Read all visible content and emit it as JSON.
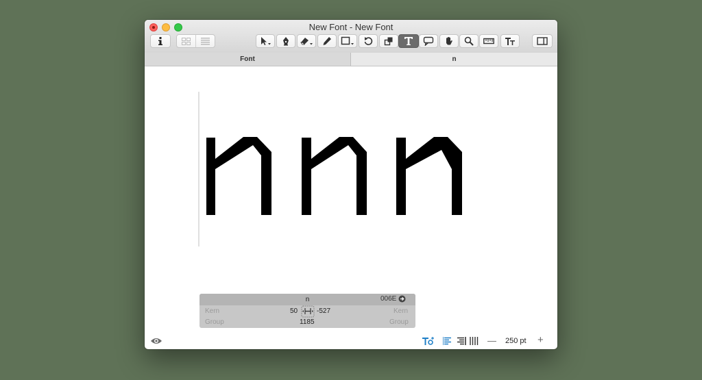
{
  "window": {
    "title": "New Font - New Font"
  },
  "tabs": [
    {
      "label": "Font"
    },
    {
      "label": "n"
    }
  ],
  "toolbar": {
    "tools": [
      "info-icon",
      "grid-view-icon",
      "list-view-icon",
      "select-tool-icon",
      "draw-tool-icon",
      "eraser-tool-icon",
      "pencil-tool-icon",
      "rectangle-tool-icon",
      "rotate-tool-icon",
      "scale-tool-icon",
      "text-tool-icon",
      "annotation-tool-icon",
      "hand-tool-icon",
      "zoom-tool-icon",
      "measure-tool-icon",
      "text-size-icon",
      "sidebar-toggle-icon"
    ],
    "active_tool": "text-tool-icon"
  },
  "canvas": {
    "glyphs": [
      "n",
      "n",
      "n"
    ]
  },
  "info_panel": {
    "glyph_name": "n",
    "unicode": "006E",
    "left_kern_label": "Kern",
    "right_kern_label": "Kern",
    "left_kern_value": "50",
    "right_kern_value": "-527",
    "left_group_label": "Group",
    "right_group_label": "Group",
    "width_value": "1185"
  },
  "statusbar": {
    "zoom_value": "250 pt",
    "zoom_out_label": "—",
    "zoom_in_label": "+"
  },
  "colors": {
    "background": "#5f7257",
    "active_tool": "#6b6b6b",
    "accent_blue": "#1f7fc7"
  }
}
